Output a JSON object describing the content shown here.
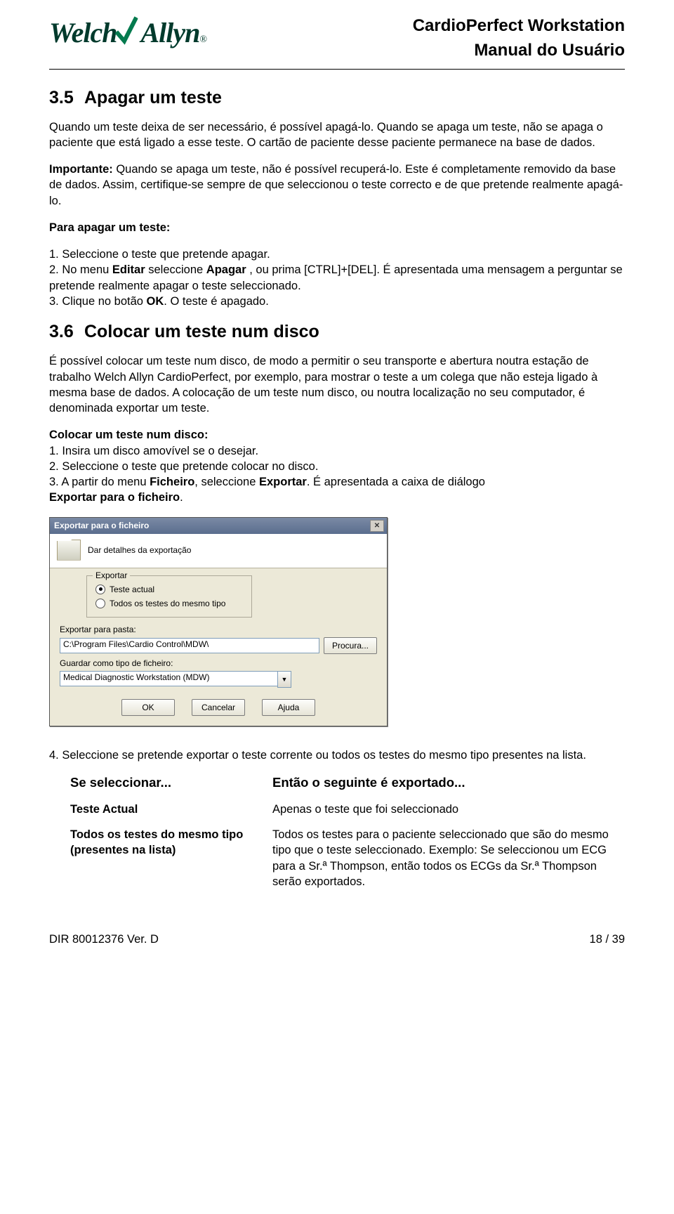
{
  "logo": {
    "brand": "WelchAllyn",
    "reg": "®"
  },
  "header": {
    "line1": "CardioPerfect Workstation",
    "line2": "Manual do Usuário"
  },
  "s35": {
    "num": "3.5",
    "title": "Apagar um teste",
    "p1": "Quando um teste deixa de ser necessário, é possível apagá-lo. Quando se apaga um teste, não se apaga o paciente que está ligado a esse teste. O cartão de paciente desse paciente permanece na base de dados.",
    "p2a": "Importante:",
    "p2b": " Quando se apaga um teste, não é possível recuperá-lo. Este é completamente removido da base de dados. Assim, certifique-se sempre de que seleccionou o teste correcto e de que pretende realmente apagá-lo.",
    "p3": "Para apagar um teste:",
    "l1": "1. Seleccione o teste que pretende apagar.",
    "l2a": "2. No menu ",
    "l2b": "Editar",
    "l2c": " seleccione ",
    "l2d": "Apagar ",
    "l2e": ", ou prima [CTRL]+[DEL]. É apresentada uma mensagem a perguntar se pretende realmente apagar o teste seleccionado.",
    "l3a": "3. Clique no botão ",
    "l3b": "OK",
    "l3c": ". O teste é apagado."
  },
  "s36": {
    "num": "3.6",
    "title": "Colocar um teste num disco",
    "p1": "É possível colocar um teste num disco, de modo a permitir o seu transporte e abertura noutra estação de trabalho Welch Allyn CardioPerfect, por exemplo, para mostrar o teste a um colega que não esteja ligado à mesma base de dados. A colocação de um teste num disco, ou noutra localização no seu computador, é denominada exportar um teste.",
    "p2": "Colocar um teste num disco:",
    "l1": "1. Insira um disco amovível se o desejar.",
    "l2": "2. Seleccione o teste que pretende colocar no disco.",
    "l3a": "3. A partir do menu ",
    "l3b": "Ficheiro",
    "l3c": ", seleccione ",
    "l3d": "Exportar",
    "l3e": ". É apresentada a caixa de diálogo ",
    "l3f": "Exportar para o ficheiro",
    "l3g": "."
  },
  "dialog": {
    "title": "Exportar para o ficheiro",
    "close": "✕",
    "subtitle": "Dar detalhes da exportação",
    "group": "Exportar",
    "opt1": "Teste actual",
    "opt2": "Todos os testes do mesmo tipo",
    "folder_label": "Exportar para pasta:",
    "folder_value": "C:\\Program Files\\Cardio Control\\MDW\\",
    "browse": "Procura...",
    "type_label": "Guardar como tipo de ficheiro:",
    "type_value": "Medical Diagnostic Workstation (MDW)",
    "ok": "OK",
    "cancel": "Cancelar",
    "help": "Ajuda"
  },
  "s4": {
    "p": "4. Seleccione se pretende exportar o teste corrente ou todos os testes do mesmo tipo presentes na lista.",
    "leftH": "Se seleccionar...",
    "leftA": "Teste Actual",
    "leftB": "Todos os testes do mesmo tipo (presentes na lista)",
    "rightH": "Então o seguinte é exportado...",
    "rightA": "Apenas o teste que foi seleccionado",
    "rightB": "Todos os testes para o paciente seleccionado que são do mesmo tipo que o teste seleccionado. Exemplo: Se seleccionou um ECG para a Sr.ª Thompson, então todos os ECGs da Sr.ª Thompson serão exportados."
  },
  "footer": {
    "left": "DIR 80012376 Ver. D",
    "right": "18  /  39"
  }
}
